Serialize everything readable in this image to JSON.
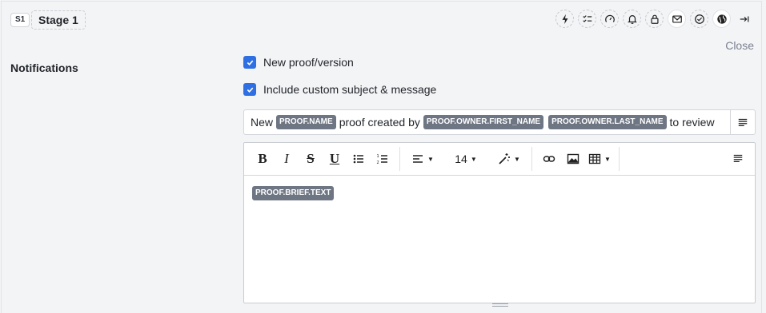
{
  "header": {
    "stage_tag": "S1",
    "stage_name": "Stage 1",
    "icons": [
      "lightning-icon",
      "checklist-icon",
      "gauge-icon",
      "bell-icon",
      "lock-icon",
      "mail-icon",
      "approval-icon",
      "globe-icon",
      "collapse-icon"
    ],
    "close_label": "Close"
  },
  "notifications": {
    "label": "Notifications",
    "new_proof_label": "New proof/version",
    "new_proof_checked": true,
    "custom_message_label": "Include custom subject & message",
    "custom_message_checked": true
  },
  "subject": {
    "prefix": "New",
    "token_name": "PROOF.NAME",
    "middle": "proof created by",
    "token_first": "PROOF.OWNER.FIRST_NAME",
    "token_last": "PROOF.OWNER.LAST_NAME",
    "suffix": "to review"
  },
  "editor": {
    "toolbar": {
      "bold": "B",
      "italic": "I",
      "strike": "S",
      "underline": "U",
      "font_size": "14"
    },
    "body_token": "PROOF.BRIEF.TEXT"
  },
  "colors": {
    "accent": "#2f6fe4",
    "token_bg": "#6e7583",
    "panel_bg": "#f3f4f6"
  }
}
